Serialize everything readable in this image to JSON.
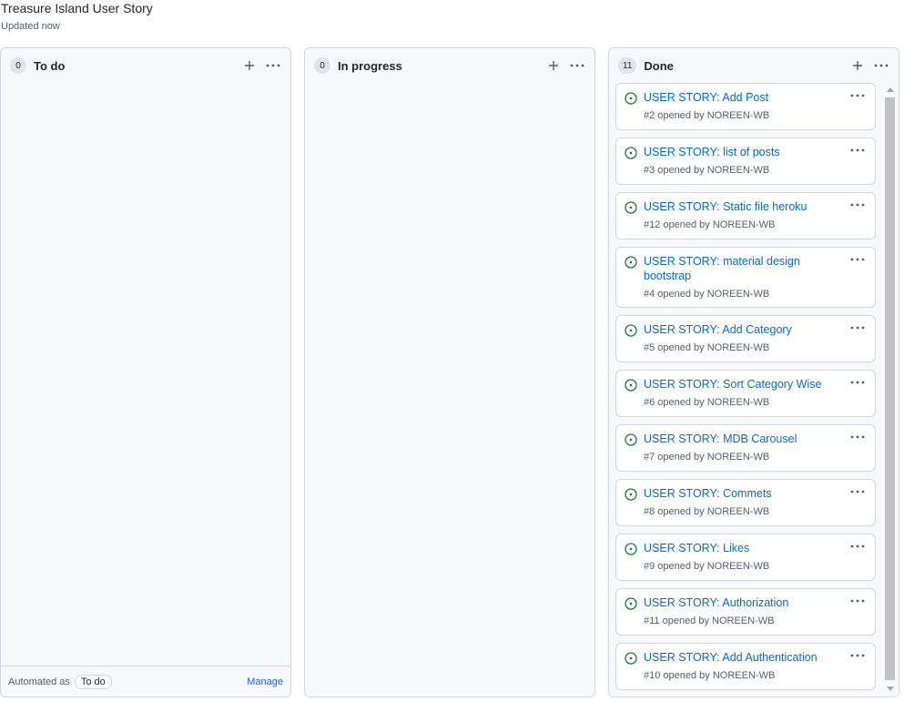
{
  "project": {
    "title": "Treasure Island User Story",
    "updated": "Updated now"
  },
  "columns": {
    "todo": {
      "count": "0",
      "name": "To do"
    },
    "progress": {
      "count": "0",
      "name": "In progress"
    },
    "done": {
      "count": "11",
      "name": "Done"
    }
  },
  "footer": {
    "automated_label": "Automated as",
    "automated_value": "To do",
    "manage_label": "Manage"
  },
  "colors": {
    "link": "#0969da",
    "open_issue": "#1a7f37",
    "column_bg": "#f6f8fa",
    "border": "#d0d7de"
  },
  "icons": {
    "add": "plus-icon",
    "menu": "kebab-horizontal-icon",
    "issue": "issue-opened-icon"
  },
  "cards": [
    {
      "title": "USER STORY: Add Post",
      "meta": "#2 opened by NOREEN-WB"
    },
    {
      "title": "USER STORY: list of posts",
      "meta": "#3 opened by NOREEN-WB"
    },
    {
      "title": "USER STORY: Static file heroku",
      "meta": "#12 opened by NOREEN-WB"
    },
    {
      "title": "USER STORY: material design bootstrap",
      "meta": "#4 opened by NOREEN-WB"
    },
    {
      "title": "USER STORY: Add Category",
      "meta": "#5 opened by NOREEN-WB"
    },
    {
      "title": "USER STORY: Sort Category Wise",
      "meta": "#6 opened by NOREEN-WB"
    },
    {
      "title": "USER STORY: MDB Carousel",
      "meta": "#7 opened by NOREEN-WB"
    },
    {
      "title": "USER STORY: Commets",
      "meta": "#8 opened by NOREEN-WB"
    },
    {
      "title": "USER STORY: Likes",
      "meta": "#9 opened by NOREEN-WB"
    },
    {
      "title": "USER STORY: Authorization",
      "meta": "#11 opened by NOREEN-WB"
    },
    {
      "title": "USER STORY: Add Authentication",
      "meta": "#10 opened by NOREEN-WB"
    }
  ]
}
